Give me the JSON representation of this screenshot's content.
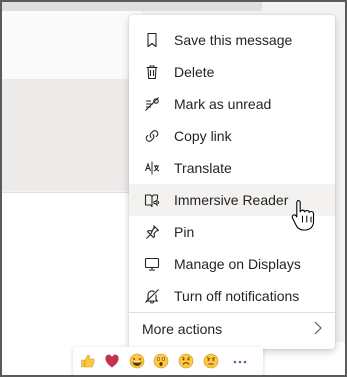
{
  "context_menu": {
    "items": [
      {
        "label": "Save this message",
        "icon": "bookmark-icon"
      },
      {
        "label": "Delete",
        "icon": "trash-icon"
      },
      {
        "label": "Mark as unread",
        "icon": "mark-unread-icon"
      },
      {
        "label": "Copy link",
        "icon": "link-icon"
      },
      {
        "label": "Translate",
        "icon": "translate-icon"
      },
      {
        "label": "Immersive Reader",
        "icon": "immersive-reader-icon",
        "hovered": true
      },
      {
        "label": "Pin",
        "icon": "pin-icon"
      },
      {
        "label": "Manage on Displays",
        "icon": "display-icon"
      },
      {
        "label": "Turn off notifications",
        "icon": "bell-off-icon"
      }
    ],
    "more_actions": {
      "label": "More actions",
      "icon": "chevron-right-icon"
    }
  },
  "reactions": [
    {
      "name": "like",
      "icon": "thumbs-up-icon"
    },
    {
      "name": "heart",
      "icon": "heart-icon"
    },
    {
      "name": "laugh",
      "icon": "laugh-icon"
    },
    {
      "name": "surprised",
      "icon": "surprised-icon"
    },
    {
      "name": "sad",
      "icon": "sad-icon"
    },
    {
      "name": "angry",
      "icon": "angry-icon"
    },
    {
      "name": "more",
      "icon": "more-reactions-icon"
    }
  ],
  "colors": {
    "hover": "#f3f2f1",
    "accent": "#6264a7",
    "text": "#252423",
    "heart": "#c4314b",
    "emoji": "#ffc83d"
  }
}
